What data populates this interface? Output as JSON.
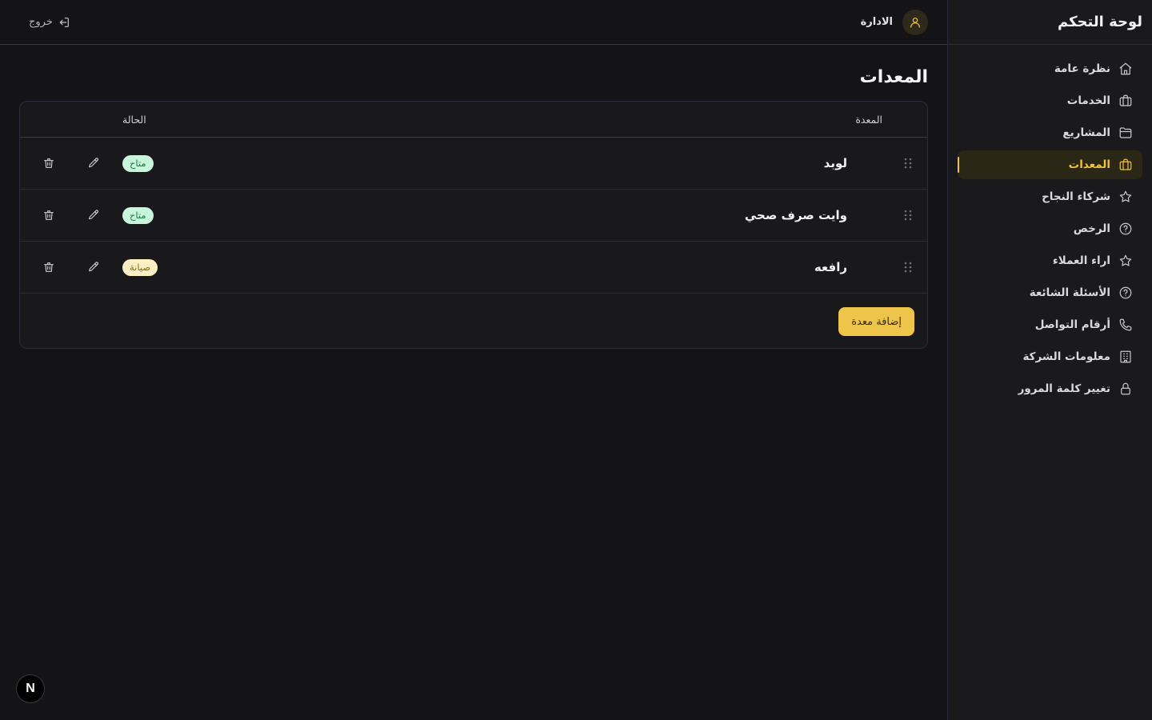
{
  "sidebar": {
    "title": "لوحة التحكم",
    "items": [
      {
        "label": "نظرة عامة",
        "icon": "home-icon",
        "active": false
      },
      {
        "label": "الخدمات",
        "icon": "briefcase-icon",
        "active": false
      },
      {
        "label": "المشاريع",
        "icon": "folder-icon",
        "active": false
      },
      {
        "label": "المعدات",
        "icon": "toolbox-icon",
        "active": true
      },
      {
        "label": "شركاء النجاح",
        "icon": "star-icon",
        "active": false
      },
      {
        "label": "الرخص",
        "icon": "help-circle-icon",
        "active": false
      },
      {
        "label": "اراء العملاء",
        "icon": "star-icon",
        "active": false
      },
      {
        "label": "الأسئلة الشائعة",
        "icon": "help-circle-icon",
        "active": false
      },
      {
        "label": "أرقام التواصل",
        "icon": "phone-icon",
        "active": false
      },
      {
        "label": "معلومات الشركة",
        "icon": "building-icon",
        "active": false
      },
      {
        "label": "تغيير كلمة المرور",
        "icon": "lock-icon",
        "active": false
      }
    ]
  },
  "topbar": {
    "user_name": "الادارة",
    "logout_label": "خروج"
  },
  "main": {
    "title": "المعدات",
    "table": {
      "columns": {
        "name": "المعدة",
        "status": "الحالة"
      },
      "rows": [
        {
          "name": "لوبد",
          "status": "متاح",
          "status_type": "available"
        },
        {
          "name": "وايت صرف صحي",
          "status": "متاح",
          "status_type": "available"
        },
        {
          "name": "رافعه",
          "status": "صيانة",
          "status_type": "maintenance"
        }
      ]
    },
    "add_button": "إضافة معدة"
  },
  "fab_label": "N",
  "colors": {
    "accent": "#f0c33c",
    "background": "#141416",
    "available_bg": "#c9f5dd",
    "maintenance_bg": "#fbefc3"
  }
}
